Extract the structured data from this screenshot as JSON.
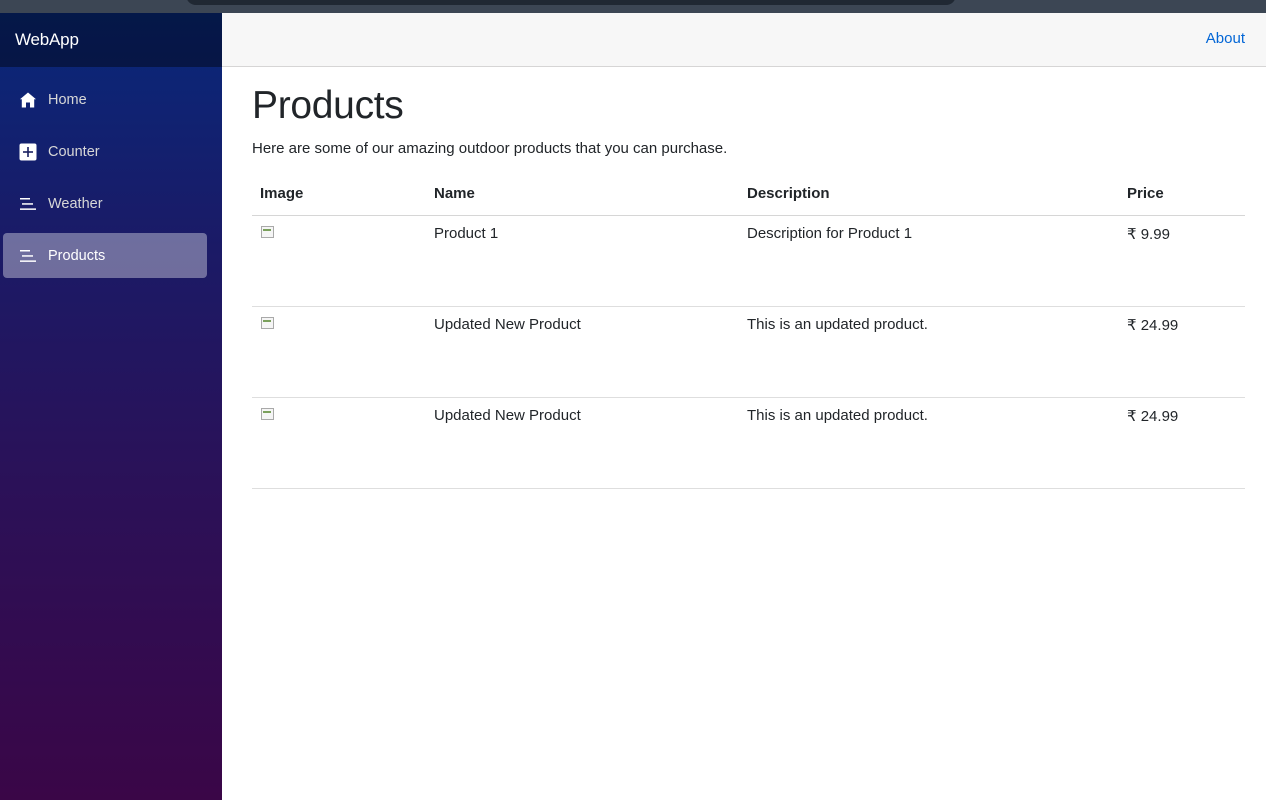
{
  "app": {
    "brand": "WebApp"
  },
  "sidebar": {
    "items": [
      {
        "label": "Home",
        "icon": "home-icon",
        "active": false
      },
      {
        "label": "Counter",
        "icon": "plus-square-icon",
        "active": false
      },
      {
        "label": "Weather",
        "icon": "list-icon",
        "active": false
      },
      {
        "label": "Products",
        "icon": "list-icon",
        "active": true
      }
    ]
  },
  "topbar": {
    "about_label": "About"
  },
  "main": {
    "title": "Products",
    "lead": "Here are some of our amazing outdoor products that you can purchase.",
    "table": {
      "headers": {
        "image": "Image",
        "name": "Name",
        "description": "Description",
        "price": "Price"
      },
      "rows": [
        {
          "image": "broken-image-icon",
          "name": "Product 1",
          "description": "Description for Product 1",
          "price": "₹ 9.99"
        },
        {
          "image": "broken-image-icon",
          "name": "Updated New Product",
          "description": "This is an updated product.",
          "price": "₹ 24.99"
        },
        {
          "image": "broken-image-icon",
          "name": "Updated New Product",
          "description": "This is an updated product.",
          "price": "₹ 24.99"
        }
      ]
    }
  },
  "colors": {
    "link": "#0366d6",
    "sidebar_top": "#08287a",
    "sidebar_bottom": "#3a0647",
    "active_nav_bg": "rgba(255,255,255,0.37)"
  }
}
